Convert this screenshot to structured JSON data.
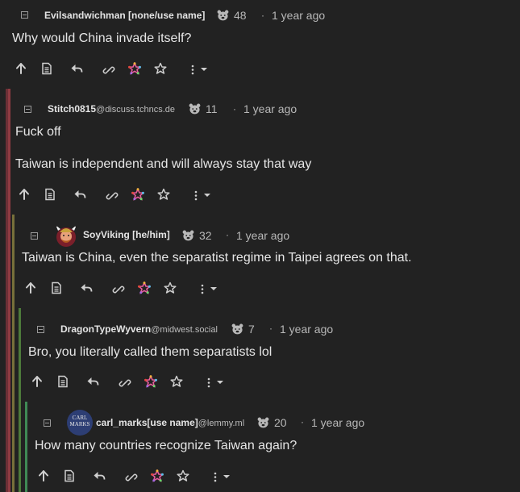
{
  "comments": [
    {
      "username": "Evilsandwichman [none/use name]",
      "instance": "",
      "score": "48",
      "time": "1 year ago",
      "paragraphs": [
        "Why would China invade itself?"
      ]
    },
    {
      "username": "Stitch0815",
      "instance": "@discuss.tchncs.de",
      "score": "11",
      "time": "1 year ago",
      "paragraphs": [
        "Fuck off",
        "Taiwan is independent and will always stay that way"
      ]
    },
    {
      "username": "SoyViking [he/him]",
      "instance": "",
      "score": "32",
      "time": "1 year ago",
      "paragraphs": [
        "Taiwan is China, even the separatist regime in Taipei agrees on that."
      ]
    },
    {
      "username": "DragonTypeWyvern",
      "instance": "@midwest.social",
      "score": "7",
      "time": "1 year ago",
      "paragraphs": [
        "Bro, you literally called them separatists lol"
      ]
    },
    {
      "username": "carl_marks[use name]",
      "instance": "@lemmy.ml",
      "score": "20",
      "time": "1 year ago",
      "paragraphs": [
        "How many countries recognize Taiwan again?"
      ]
    }
  ],
  "avatar_text": {
    "line1": "CARL",
    "line2": "MARKS"
  },
  "separator": "·",
  "icons": {
    "collapse": "minus-square-icon",
    "score": "hexbear-icon",
    "upvote": "arrow-up-icon",
    "source": "document-icon",
    "reply": "reply-icon",
    "link": "link-icon",
    "federated": "fediverse-star-icon",
    "save": "star-icon",
    "more": "more-vertical-icon"
  },
  "colors": {
    "background": "#222222",
    "text": "#dedede",
    "muted": "#b8b8b8",
    "thread_lines": [
      "#6b3036",
      "#8f3b42",
      "#77703a",
      "#4d7a3a",
      "#3f8a55"
    ]
  }
}
